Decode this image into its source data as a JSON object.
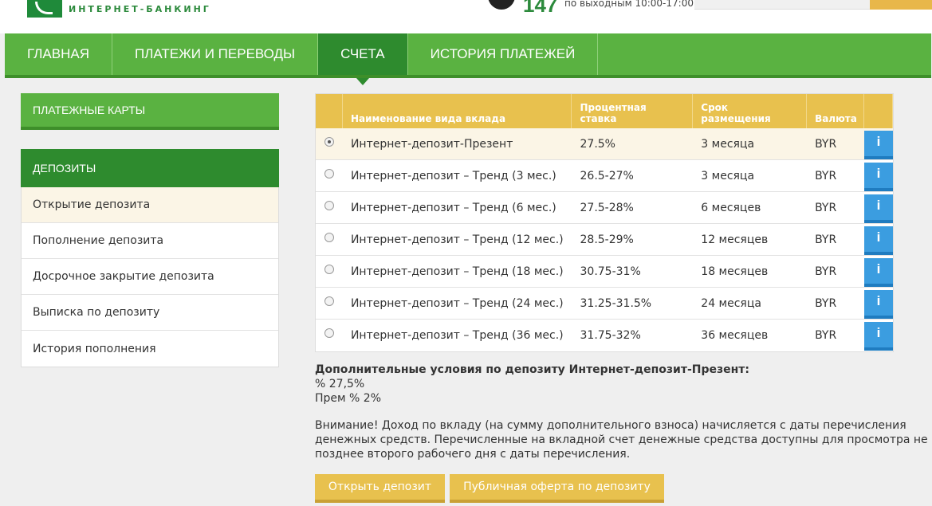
{
  "header": {
    "logo_text": "ИНТЕРНЕТ-БАНКИНГ",
    "phone_number": "147",
    "phone_hours": "по выходным 10:00-17:00)"
  },
  "nav": {
    "items": [
      {
        "label": "ГЛАВНАЯ"
      },
      {
        "label": "ПЛАТЕЖИ И ПЕРЕВОДЫ"
      },
      {
        "label": "СЧЕТА"
      },
      {
        "label": "ИСТОРИЯ ПЛАТЕЖЕЙ"
      }
    ],
    "active_index": 2
  },
  "sidebar": {
    "cards_heading": "ПЛАТЕЖНЫЕ КАРТЫ",
    "deposits_heading": "ДЕПОЗИТЫ",
    "items": [
      {
        "label": "Открытие депозита"
      },
      {
        "label": "Пополнение депозита"
      },
      {
        "label": "Досрочное закрытие депозита"
      },
      {
        "label": "Выписка по депозиту"
      },
      {
        "label": "История пополнения"
      }
    ]
  },
  "table": {
    "headers": {
      "name": "Наименование вида вклада",
      "rate": "Процентная ставка",
      "term": "Срок размещения",
      "currency": "Валюта"
    },
    "rows": [
      {
        "name": "Интернет-депозит-Презент",
        "rate": "27.5%",
        "term": "3 месяца",
        "currency": "BYR",
        "info": "i"
      },
      {
        "name": "Интернет-депозит – Тренд (3 мес.)",
        "rate": "26.5-27%",
        "term": "3 месяца",
        "currency": "BYR",
        "info": "i"
      },
      {
        "name": "Интернет-депозит – Тренд (6 мес.)",
        "rate": "27.5-28%",
        "term": "6 месяцев",
        "currency": "BYR",
        "info": "i"
      },
      {
        "name": "Интернет-депозит – Тренд (12 мес.)",
        "rate": "28.5-29%",
        "term": "12 месяцев",
        "currency": "BYR",
        "info": "i"
      },
      {
        "name": "Интернет-депозит – Тренд (18 мес.)",
        "rate": "30.75-31%",
        "term": "18 месяцев",
        "currency": "BYR",
        "info": "i"
      },
      {
        "name": "Интернет-депозит – Тренд (24 мес.)",
        "rate": "31.25-31.5%",
        "term": "24 месяца",
        "currency": "BYR",
        "info": "i"
      },
      {
        "name": "Интернет-депозит – Тренд (36 мес.)",
        "rate": "31.75-32%",
        "term": "36 месяцев",
        "currency": "BYR",
        "info": "i"
      }
    ]
  },
  "details": {
    "title": "Дополнительные условия по депозиту Интернет-депозит-Презент:",
    "line1": "% 27,5%",
    "line2": "Прем % 2%",
    "note": "Внимание! Доход по вкладу (на сумму дополнительного взноса) начисляется с даты перечисления денежных средств. Перечисленные на вкладной счет денежные средства доступны для просмотра не позднее второго рабочего дня с даты перечисления."
  },
  "buttons": {
    "open": "Открыть депозит",
    "offer": "Публичная оферта по депозиту"
  },
  "colors": {
    "green": "#5ab241",
    "dark_green": "#2e8b2e",
    "yellow": "#e8c14e",
    "blue": "#3b9de0"
  }
}
